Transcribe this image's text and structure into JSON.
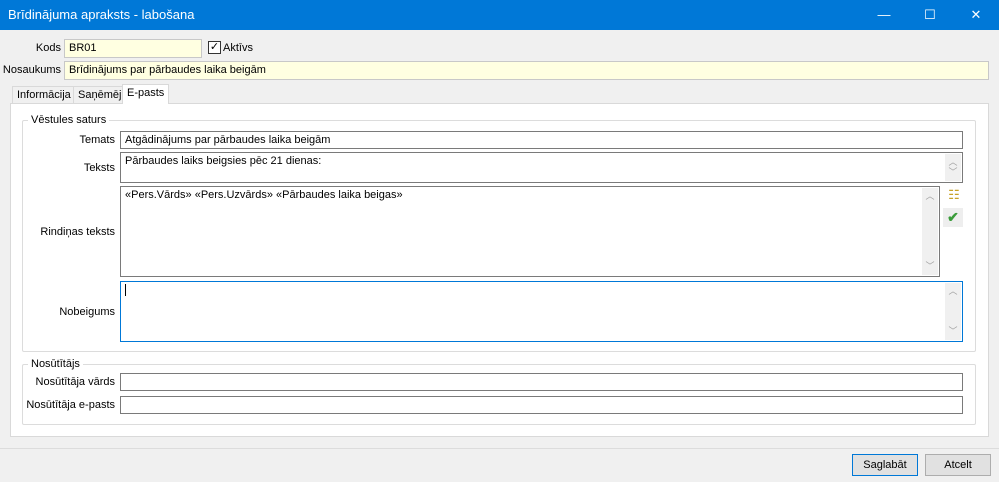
{
  "window": {
    "title": "Brīdinājuma apraksts - labošana",
    "minimize": "—",
    "maximize": "☐",
    "close": "✕"
  },
  "header": {
    "kods_label": "Kods",
    "kods_value": "BR01",
    "aktivs_label": "Aktīvs",
    "aktivs_checked": true,
    "nosaukums_label": "Nosaukums",
    "nosaukums_value": "Brīdinājums par pārbaudes laika beigām"
  },
  "tabs": [
    {
      "label": "Informācija"
    },
    {
      "label": "Saņēmēji"
    },
    {
      "label": "E-pasts",
      "active": true
    }
  ],
  "letter": {
    "group_title": "Vēstules saturs",
    "temats_label": "Temats",
    "temats_value": "Atgādinājums par pārbaudes laika beigām",
    "teksts_label": "Teksts",
    "teksts_value": "Pārbaudes laiks beigsies pēc 21 dienas:",
    "rindinas_label": "Rindiņas teksts",
    "rindinas_value": "«Pers.Vārds» «Pers.Uzvārds» «Pārbaudes laika beigas»",
    "nobeigums_label": "Nobeigums",
    "nobeigums_value": ""
  },
  "sender": {
    "group_title": "Nosūtītājs",
    "name_label": "Nosūtītāja vārds",
    "name_value": "",
    "email_label": "Nosūtītāja e-pasts",
    "email_value": ""
  },
  "footer": {
    "save": "Saglabāt",
    "cancel": "Atcelt"
  },
  "colors": {
    "titlebar": "#0078d7",
    "focus": "#0078d7",
    "input_required": "#ffffe1"
  }
}
